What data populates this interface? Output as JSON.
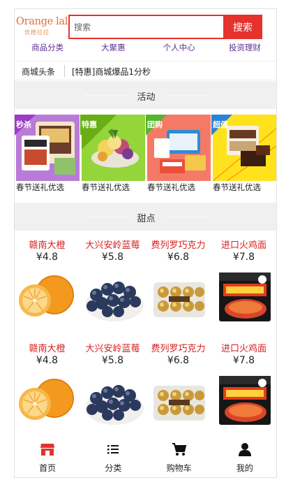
{
  "header": {
    "logo_text": "Orange lala.",
    "logo_subtext": "优橙拉拉",
    "search_placeholder": "搜索",
    "search_button": "搜索"
  },
  "nav": [
    "商品分类",
    "大聚惠",
    "个人中心",
    "投资理财"
  ],
  "news": {
    "label": "商城头条",
    "text": "[特惠]商城爆品1分秒"
  },
  "sections": {
    "activity": "活动",
    "dessert": "甜点"
  },
  "promotions": [
    {
      "tag": "秒杀",
      "caption": "春节送礼优选",
      "bg": "#b97bd8",
      "tag_color": "#9c3cc7"
    },
    {
      "tag": "特惠",
      "caption": "春节送礼优选",
      "bg": "#93d53a",
      "tag_color": "#6aae16"
    },
    {
      "tag": "团购",
      "caption": "春节送礼优选",
      "bg": "#f47a66",
      "tag_color": "#55b52f"
    },
    {
      "tag": "超值",
      "caption": "春节送礼优选",
      "bg": "#ffe21c",
      "tag_color": "#2a83d8"
    }
  ],
  "products_row1": [
    {
      "name": "赣南大橙",
      "price": "¥4.8",
      "icon": "orange-fruit"
    },
    {
      "name": "大兴安岭蓝莓",
      "price": "¥5.8",
      "icon": "blueberries"
    },
    {
      "name": "费列罗巧克力",
      "price": "¥6.8",
      "icon": "chocolate-box"
    },
    {
      "name": "进口火鸡面",
      "price": "¥7.8",
      "icon": "noodle-pack"
    }
  ],
  "products_row2": [
    {
      "name": "赣南大橙",
      "price": "¥4.8",
      "icon": "orange-fruit"
    },
    {
      "name": "大兴安岭蓝莓",
      "price": "¥5.8",
      "icon": "blueberries"
    },
    {
      "name": "费列罗巧克力",
      "price": "¥6.8",
      "icon": "chocolate-box"
    },
    {
      "name": "进口火鸡面",
      "price": "¥7.8",
      "icon": "noodle-pack"
    }
  ],
  "tabs": [
    {
      "label": "首页",
      "icon": "home-shop-icon",
      "color": "#e5322d"
    },
    {
      "label": "分类",
      "icon": "list-icon",
      "color": "#111111"
    },
    {
      "label": "购物车",
      "icon": "cart-icon",
      "color": "#111111"
    },
    {
      "label": "我的",
      "icon": "user-icon",
      "color": "#111111"
    }
  ],
  "colors": {
    "accent": "#e5322d",
    "nav_text": "#5b2f90",
    "price_name": "#d61f1f"
  }
}
